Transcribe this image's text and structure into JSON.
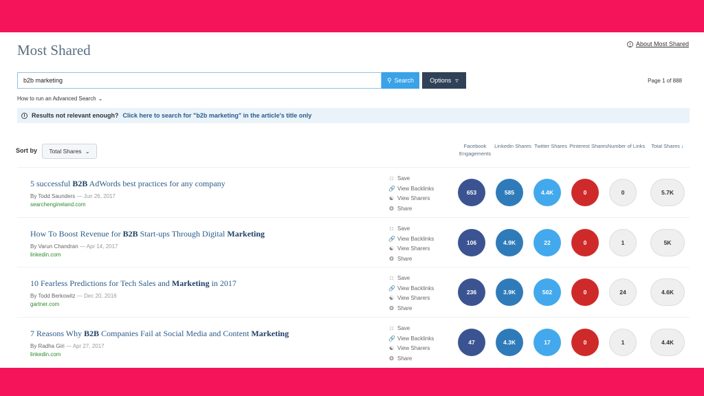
{
  "page": {
    "title": "Most Shared",
    "about_label": "About Most Shared",
    "page_info": "Page 1 of 888"
  },
  "search": {
    "value": "b2b marketing",
    "button_label": "Search",
    "options_label": "Options"
  },
  "advanced_search_label": "How to run an Advanced Search",
  "notice": {
    "prefix": "Results not relevant enough?",
    "link": "Click here to search for \"b2b marketing\" in the article's title only"
  },
  "sort": {
    "label": "Sort by",
    "selected": "Total Shares"
  },
  "columns": {
    "facebook": "Facebook Engagements",
    "linkedin": "Linkedin Shares",
    "twitter": "Twitter Shares",
    "pinterest": "Pinterest Shares",
    "links": "Number of Links",
    "total": "Total Shares"
  },
  "actions": {
    "save": "Save",
    "backlinks": "View Backlinks",
    "sharers": "View Sharers",
    "share": "Share"
  },
  "colors": {
    "accent_bg": "#f5135a",
    "facebook": "#3b5491",
    "linkedin": "#2f7bba",
    "twitter": "#43a9ec",
    "pinterest": "#cf2a2a"
  },
  "results": [
    {
      "title_parts": [
        "5 successful ",
        "B2B",
        " AdWords best practices for any company"
      ],
      "author": "By Todd Saunders",
      "date": "Jun 26, 2017",
      "domain": "searchengineland.com",
      "facebook": "653",
      "linkedin": "585",
      "twitter": "4.4K",
      "pinterest": "0",
      "links": "0",
      "total": "5.7K"
    },
    {
      "title_parts": [
        "How To Boost Revenue for ",
        "B2B",
        " Start-ups Through Digital ",
        "Marketing"
      ],
      "author": "By Varun Chandran",
      "date": "Apr 14, 2017",
      "domain": "linkedin.com",
      "facebook": "106",
      "linkedin": "4.9K",
      "twitter": "22",
      "pinterest": "0",
      "links": "1",
      "total": "5K"
    },
    {
      "title_parts": [
        "10 Fearless Predictions for Tech Sales and ",
        "Marketing",
        " in 2017"
      ],
      "author": "By Todd Berkowitz",
      "date": "Dec 20, 2016",
      "domain": "gartner.com",
      "facebook": "236",
      "linkedin": "3.9K",
      "twitter": "502",
      "pinterest": "0",
      "links": "24",
      "total": "4.6K"
    },
    {
      "title_parts": [
        "7 Reasons Why ",
        "B2B",
        " Companies Fail at Social Media and Content ",
        "Marketing"
      ],
      "author": "By Radha Giri",
      "date": "Apr 27, 2017",
      "domain": "linkedin.com",
      "facebook": "47",
      "linkedin": "4.3K",
      "twitter": "17",
      "pinterest": "0",
      "links": "1",
      "total": "4.4K"
    }
  ]
}
